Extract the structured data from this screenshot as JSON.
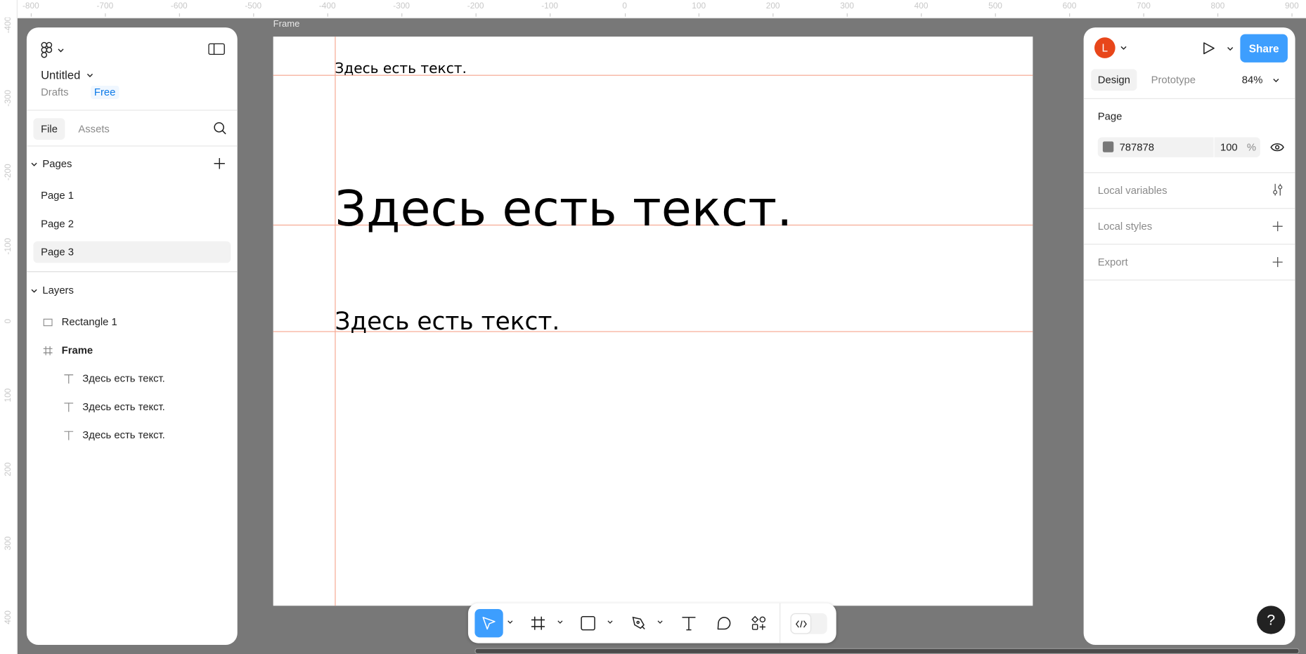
{
  "rulers": {
    "top": [
      "-800",
      "-700",
      "-600",
      "-500",
      "-400",
      "-300",
      "-200",
      "-100",
      "0",
      "100",
      "200",
      "300",
      "400",
      "500",
      "600",
      "700",
      "800",
      "900"
    ],
    "left": [
      "-400",
      "-300",
      "-200",
      "-100",
      "0",
      "100",
      "200",
      "300",
      "400"
    ]
  },
  "left_panel": {
    "file_name": "Untitled",
    "location": "Drafts",
    "plan": "Free",
    "tabs": [
      {
        "label": "File",
        "active": true
      },
      {
        "label": "Assets",
        "active": false
      }
    ],
    "pages_header": "Pages",
    "pages": [
      {
        "label": "Page 1"
      },
      {
        "label": "Page 2"
      },
      {
        "label": "Page 3",
        "selected": true
      }
    ],
    "layers_header": "Layers",
    "layers": [
      {
        "label": "Rectangle 1",
        "icon": "rectangle-icon"
      },
      {
        "label": "Frame",
        "icon": "frame-icon"
      },
      {
        "label": "Здесь есть текст.",
        "icon": "text-icon"
      },
      {
        "label": "Здесь есть текст.",
        "icon": "text-icon"
      },
      {
        "label": "Здесь есть текст.",
        "icon": "text-icon"
      }
    ]
  },
  "canvas": {
    "background": "#787878",
    "frame_label": "Frame",
    "guide_color": "#f6a892",
    "texts": [
      "Здесь есть текст.",
      "Здесь есть текст.",
      "Здесь есть текст."
    ]
  },
  "right_panel": {
    "avatar_letter": "L",
    "avatar_color": "#e8461a",
    "share_label": "Share",
    "share_color": "#3d9efe",
    "tabs": [
      {
        "label": "Design",
        "active": true
      },
      {
        "label": "Prototype",
        "active": false
      }
    ],
    "zoom": "84%",
    "page_section": "Page",
    "page_color": "787878",
    "page_opacity": "100",
    "percent": "%",
    "sections": [
      "Local variables",
      "Local styles",
      "Export"
    ]
  },
  "toolbar": {
    "tools": [
      "move-tool",
      "frame-tool",
      "rectangle-tool",
      "pen-tool",
      "text-tool",
      "comment-tool",
      "actions-tool"
    ],
    "active": "move-tool",
    "dev_mode": false
  },
  "help_label": "?"
}
